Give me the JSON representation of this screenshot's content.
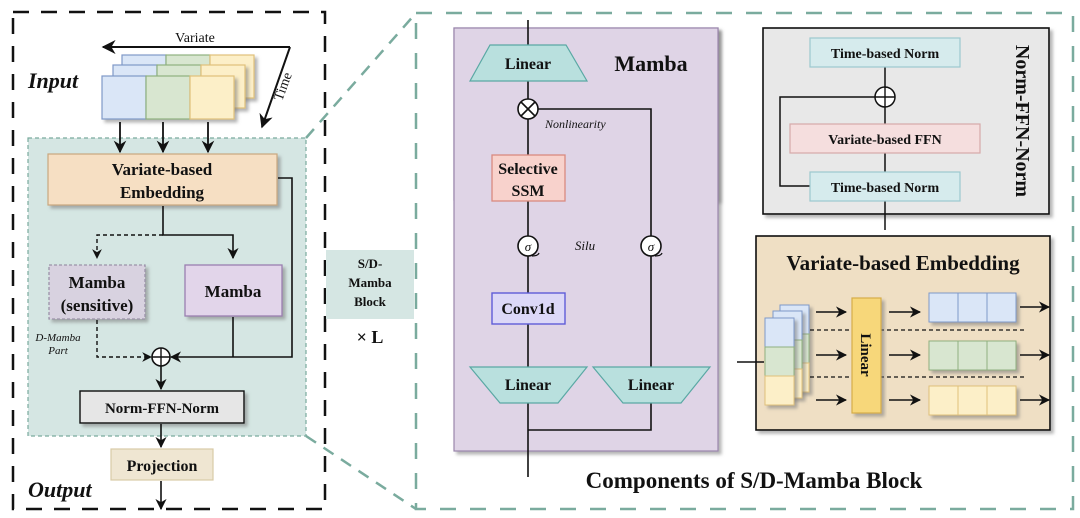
{
  "left_panel": {
    "input_label": "Input",
    "output_label": "Output",
    "axis_variate": "Variate",
    "axis_time": "Time",
    "embedding_line1": "Variate-based",
    "embedding_line2": "Embedding",
    "mamba_sensitive_line1": "Mamba",
    "mamba_sensitive_line2": "(sensitive)",
    "mamba": "Mamba",
    "dmamba_line1": "D-Mamba",
    "dmamba_line2": "Part",
    "norm_ffn_norm": "Norm-FFN-Norm",
    "projection": "Projection"
  },
  "block_label": {
    "line1": "S/D-",
    "line2": "Mamba",
    "line3": "Block",
    "repeat": "× L"
  },
  "mamba_panel": {
    "title": "Mamba",
    "linear_top": "Linear",
    "nonlinearity": "Nonlinearity",
    "selective_ssm_line1": "Selective",
    "selective_ssm_line2": "SSM",
    "sigma": "σ",
    "silu": "Silu",
    "conv1d": "Conv1d",
    "linear_bottom_left": "Linear",
    "linear_bottom_right": "Linear"
  },
  "norm_panel": {
    "title": "Norm-FFN-Norm",
    "time_norm_top": "Time-based Norm",
    "variate_ffn": "Variate-based FFN",
    "time_norm_bottom": "Time-based Norm"
  },
  "embedding_panel": {
    "title": "Variate-based Embedding",
    "linear": "Linear"
  },
  "caption": "Components of S/D-Mamba Block",
  "colors": {
    "blue": "#dae6f7",
    "green": "#d8e6d0",
    "yellow": "#fcefc8",
    "teal_bg": "#d5e6e3",
    "orange_box": "#f6dfc3",
    "mamba_purple": "#e2d5ea",
    "mamba_panel": "#dfd4e6",
    "trapezoid": "#b9e0de",
    "ssm_red": "#f8d2cc",
    "conv_blue": "#dcd8f7",
    "norm_gray": "#e8e8e8",
    "norm_cyan": "#d6ebed",
    "ffn_pink": "#f5dede",
    "embed_tan": "#efdfc4",
    "linear_yellow": "#f7d77a",
    "projection_tan": "#efe6d2",
    "dash_teal": "#7aab9e"
  }
}
